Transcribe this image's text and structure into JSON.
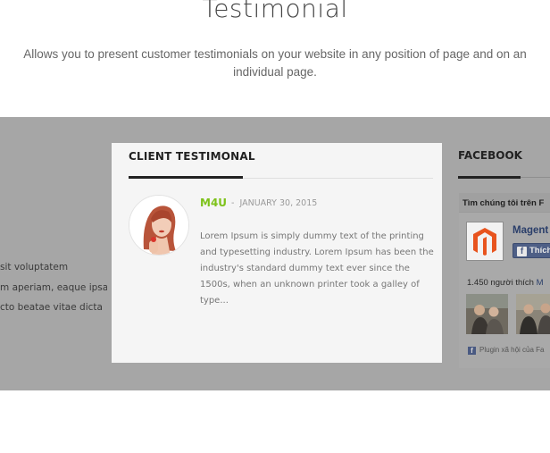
{
  "header": {
    "title": "Testimonial",
    "description": "Allows you to present customer testimonials on your website in any position of page and on an individual page."
  },
  "left_fragment": {
    "lines": [
      "sit voluptatem",
      "m aperiam, eaque ipsa",
      "cto beatae vitae dicta"
    ]
  },
  "testimonial": {
    "heading": "CLIENT TESTIMONAL",
    "author": "M4U",
    "separator": "-",
    "date": "JANUARY 30, 2015",
    "quote": "Lorem Ipsum is simply dummy text of the printing and typesetting industry. Lorem Ipsum has been the industry's standard dummy text ever since the 1500s, when an unknown printer took a galley of type...",
    "author_color": "#7ec21b"
  },
  "facebook": {
    "heading": "FACEBOOK",
    "find_us": "Tìm chúng tôi trên F",
    "page_name": "Magent",
    "like_label": "Thích",
    "like_count": "1.450 người thích",
    "like_count_tail": "M",
    "plugin_text": "Plugin xã hội của Fa"
  },
  "colors": {
    "band": "#a6a6a6",
    "card": "#f5f5f5",
    "facebook_blue": "#4e5f86",
    "magento_orange": "#e8541e"
  }
}
